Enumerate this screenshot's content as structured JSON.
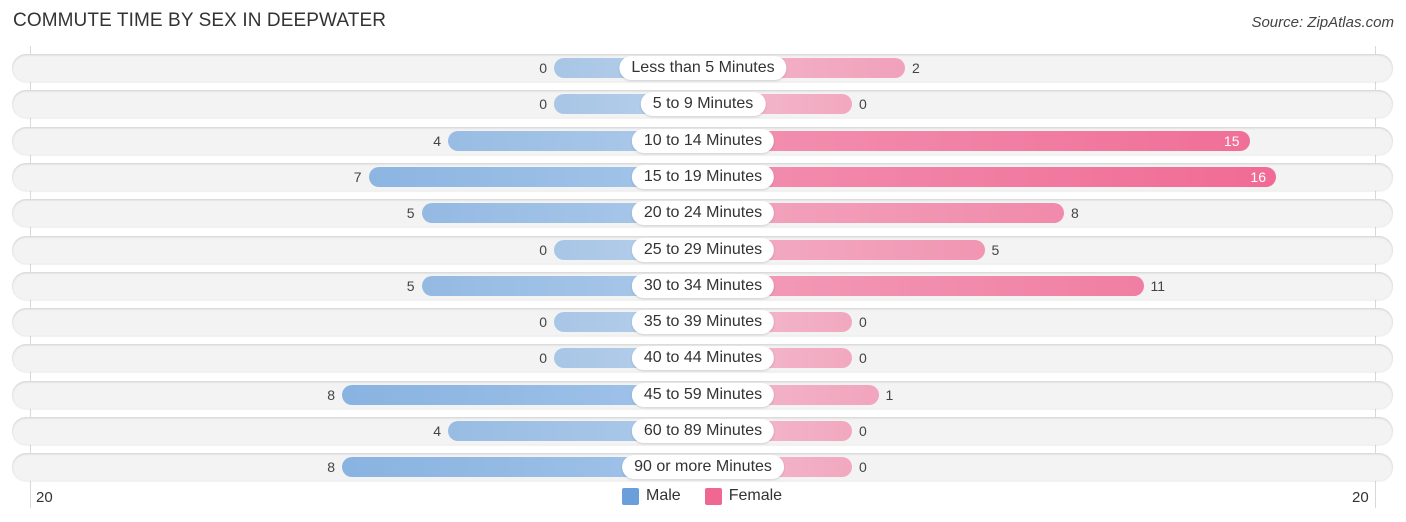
{
  "title": "COMMUTE TIME BY SEX IN DEEPWATER",
  "source": "Source: ZipAtlas.com",
  "colors": {
    "male": "#6aa0db",
    "female": "#f06b96",
    "male_light": "#aecbec",
    "female_light": "#f7a8c2"
  },
  "axis": {
    "left_label": "20",
    "right_label": "20"
  },
  "legend": [
    {
      "name": "Male",
      "color": "#6a9fdc"
    },
    {
      "name": "Female",
      "color": "#f06792"
    }
  ],
  "chart_data": {
    "type": "bar",
    "orientation": "horizontal-diverging",
    "title": "COMMUTE TIME BY SEX IN DEEPWATER",
    "categories": [
      "Less than 5 Minutes",
      "5 to 9 Minutes",
      "10 to 14 Minutes",
      "15 to 19 Minutes",
      "20 to 24 Minutes",
      "25 to 29 Minutes",
      "30 to 34 Minutes",
      "35 to 39 Minutes",
      "40 to 44 Minutes",
      "45 to 59 Minutes",
      "60 to 89 Minutes",
      "90 or more Minutes"
    ],
    "series": [
      {
        "name": "Male",
        "values": [
          0,
          0,
          4,
          7,
          5,
          0,
          5,
          0,
          0,
          8,
          4,
          8
        ]
      },
      {
        "name": "Female",
        "values": [
          2,
          0,
          15,
          16,
          8,
          5,
          11,
          0,
          0,
          1,
          0,
          0
        ]
      }
    ],
    "xlim": [
      -20,
      20
    ],
    "xtick_labels": [
      "20",
      "20"
    ],
    "legend_position": "bottom-center",
    "grid": false
  }
}
